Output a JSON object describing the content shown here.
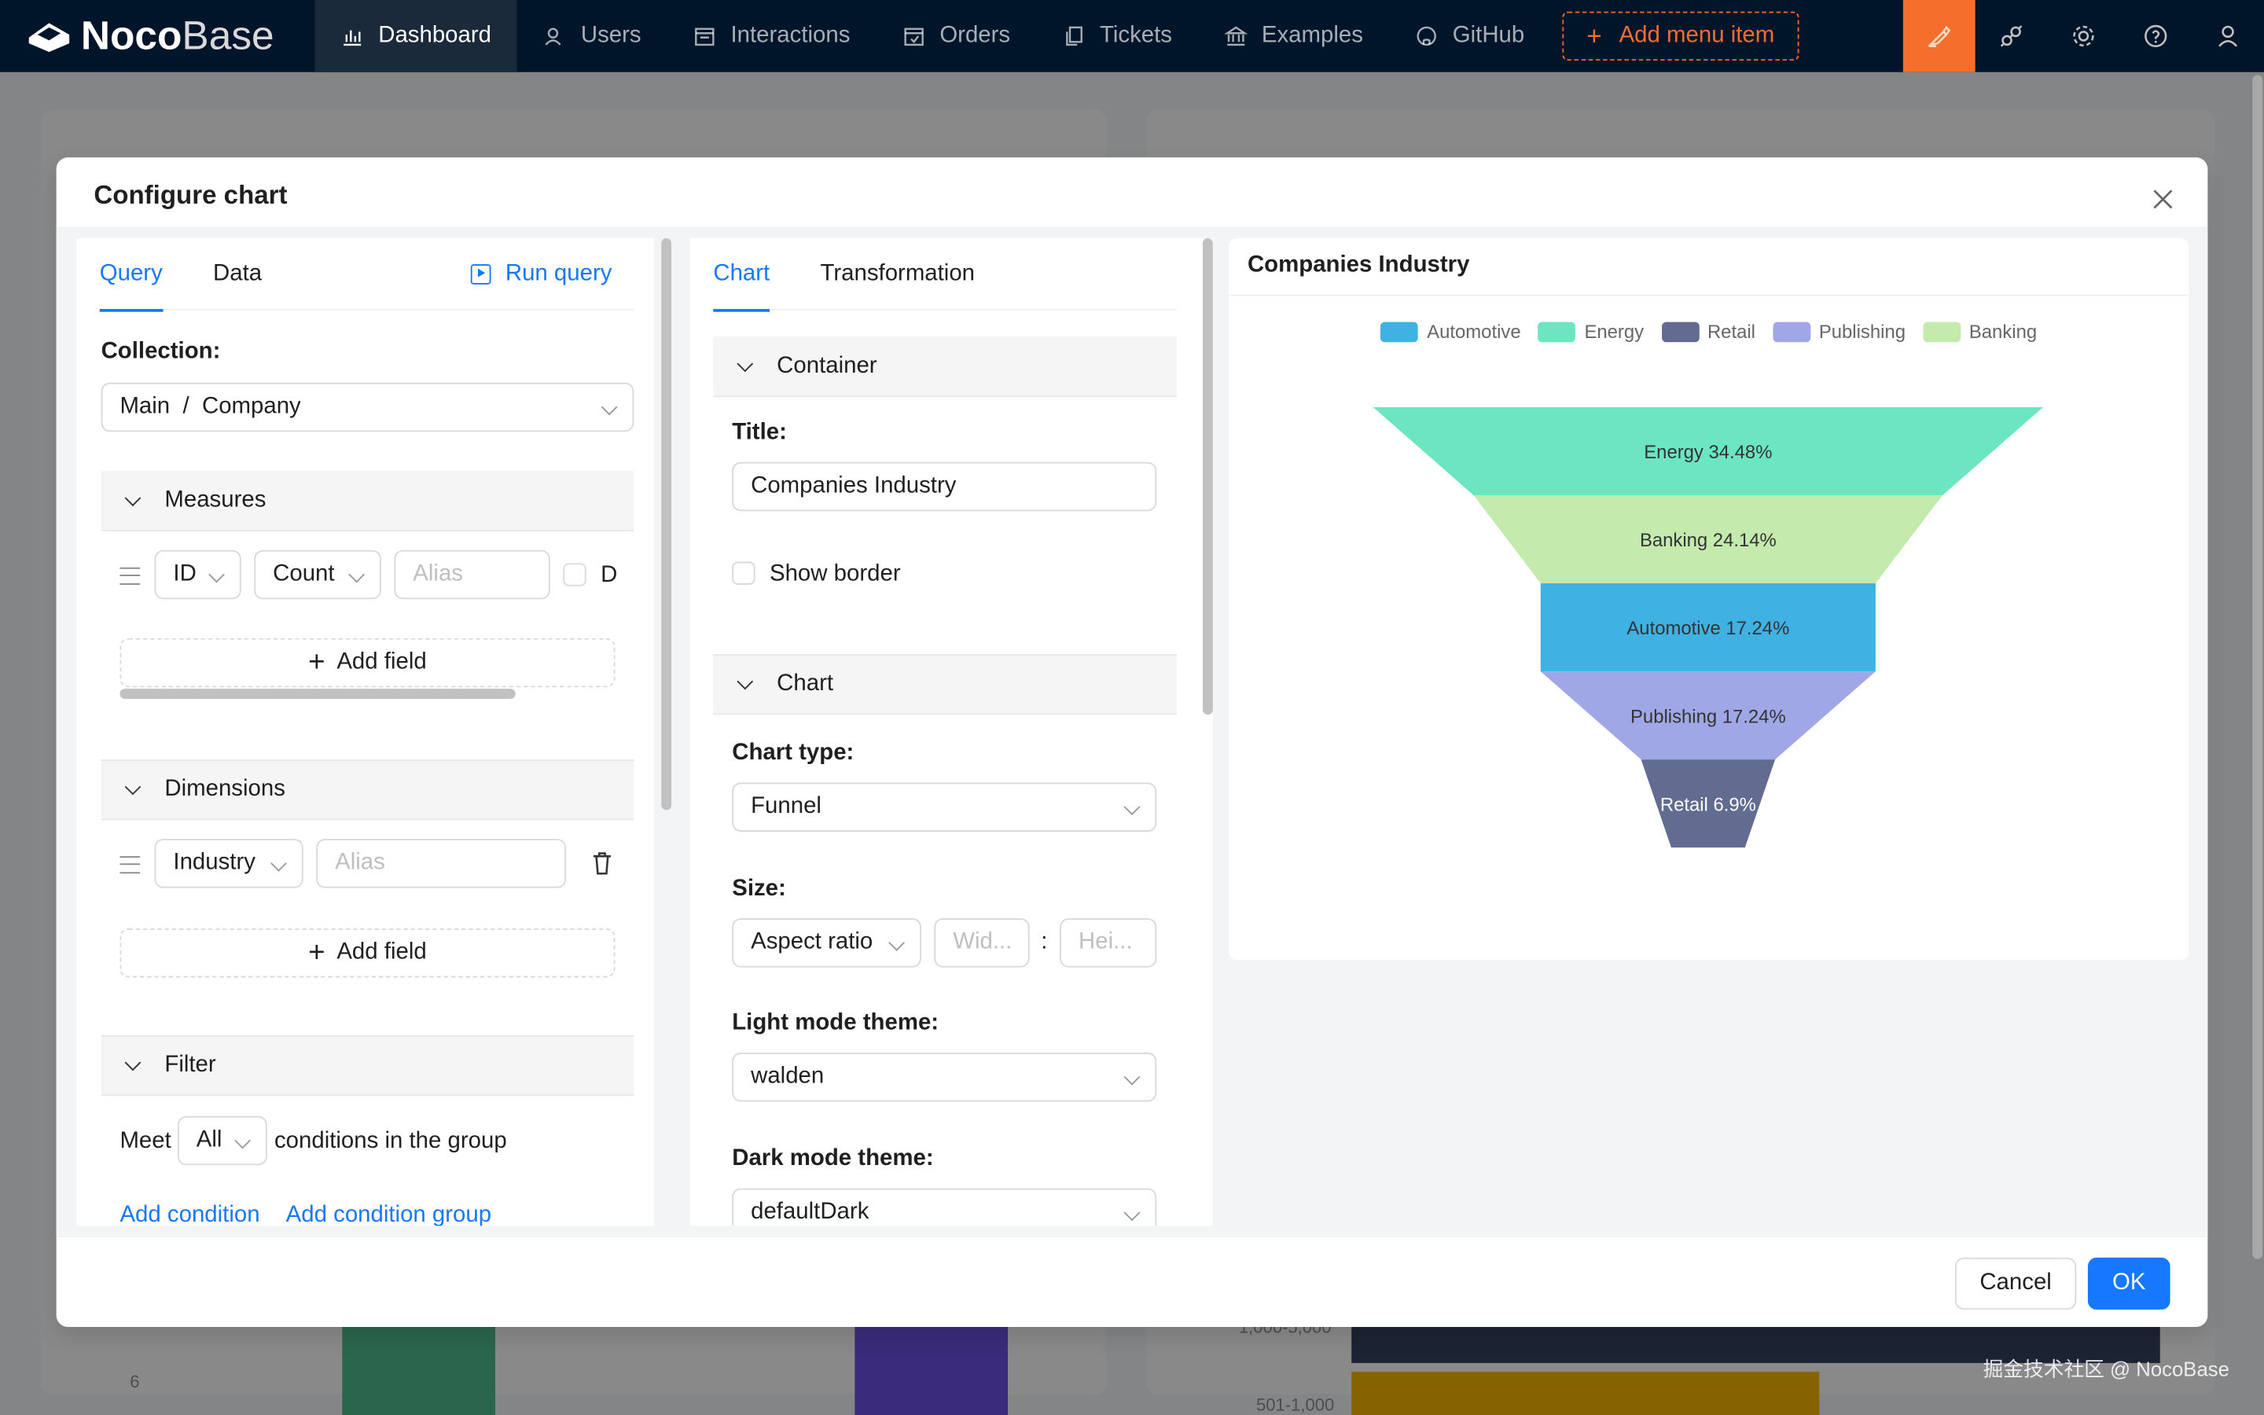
{
  "app": {
    "logo_bold": "Noco",
    "logo_light": "Base"
  },
  "nav": {
    "items": [
      {
        "label": "Dashboard",
        "icon": "bar-chart-icon",
        "active": true
      },
      {
        "label": "Users",
        "icon": "user-group-icon",
        "active": false
      },
      {
        "label": "Interactions",
        "icon": "calendar-icon",
        "active": false
      },
      {
        "label": "Orders",
        "icon": "calendar-check-icon",
        "active": false
      },
      {
        "label": "Tickets",
        "icon": "copy-icon",
        "active": false
      },
      {
        "label": "Examples",
        "icon": "bank-icon",
        "active": false
      },
      {
        "label": "GitHub",
        "icon": "github-icon",
        "active": false
      }
    ],
    "add_menu_item": "Add menu item"
  },
  "background": {
    "ticks": [
      "6",
      "1,000-5,000",
      "501-1,000"
    ]
  },
  "modal": {
    "title": "Configure chart",
    "cancel": "Cancel",
    "ok": "OK"
  },
  "query": {
    "tabs": [
      "Query",
      "Data"
    ],
    "run_query": "Run query",
    "collection_label": "Collection",
    "collection_value": "Main  /  Company",
    "measures": {
      "title": "Measures",
      "field": "ID",
      "aggregation": "Count",
      "alias_placeholder": "Alias",
      "checkbox_label": "D",
      "add_field": "Add field"
    },
    "dimensions": {
      "title": "Dimensions",
      "field": "Industry",
      "alias_placeholder": "Alias",
      "add_field": "Add field"
    },
    "filter": {
      "title": "Filter",
      "meet": "Meet",
      "all": "All",
      "conditions_text": "conditions in the group",
      "add_condition": "Add condition",
      "add_condition_group": "Add condition group"
    }
  },
  "config": {
    "tabs": [
      "Chart",
      "Transformation"
    ],
    "container": {
      "title": "Container",
      "title_label": "Title",
      "title_value": "Companies Industry",
      "show_border": "Show border"
    },
    "chart": {
      "title": "Chart",
      "chart_type_label": "Chart type",
      "chart_type_value": "Funnel",
      "size_label": "Size",
      "size_mode": "Aspect ratio",
      "width_placeholder": "Wid...",
      "size_sep": ":",
      "height_placeholder": "Hei...",
      "light_theme_label": "Light mode theme",
      "light_theme_value": "walden",
      "dark_theme_label": "Dark mode theme",
      "dark_theme_value": "defaultDark"
    }
  },
  "preview": {
    "title": "Companies Industry"
  },
  "chart_data": {
    "type": "funnel",
    "title": "Companies Industry",
    "legend": [
      {
        "name": "Automotive",
        "color": "#3fb1e3"
      },
      {
        "name": "Energy",
        "color": "#6be6c1"
      },
      {
        "name": "Retail",
        "color": "#626c91"
      },
      {
        "name": "Publishing",
        "color": "#a0a7e6"
      },
      {
        "name": "Banking",
        "color": "#c4ebad"
      }
    ],
    "stages": [
      {
        "name": "Energy",
        "percent": 34.48,
        "label": "Energy 34.48%",
        "color": "#6be6c1"
      },
      {
        "name": "Banking",
        "percent": 24.14,
        "label": "Banking 24.14%",
        "color": "#c4ebad"
      },
      {
        "name": "Automotive",
        "percent": 17.24,
        "label": "Automotive 17.24%",
        "color": "#3fb1e3"
      },
      {
        "name": "Publishing",
        "percent": 17.24,
        "label": "Publishing 17.24%",
        "color": "#a0a7e6"
      },
      {
        "name": "Retail",
        "percent": 6.9,
        "label": "Retail 6.9%",
        "color": "#626c91"
      }
    ]
  },
  "watermark": "掘金技术社区 @ NocoBase"
}
